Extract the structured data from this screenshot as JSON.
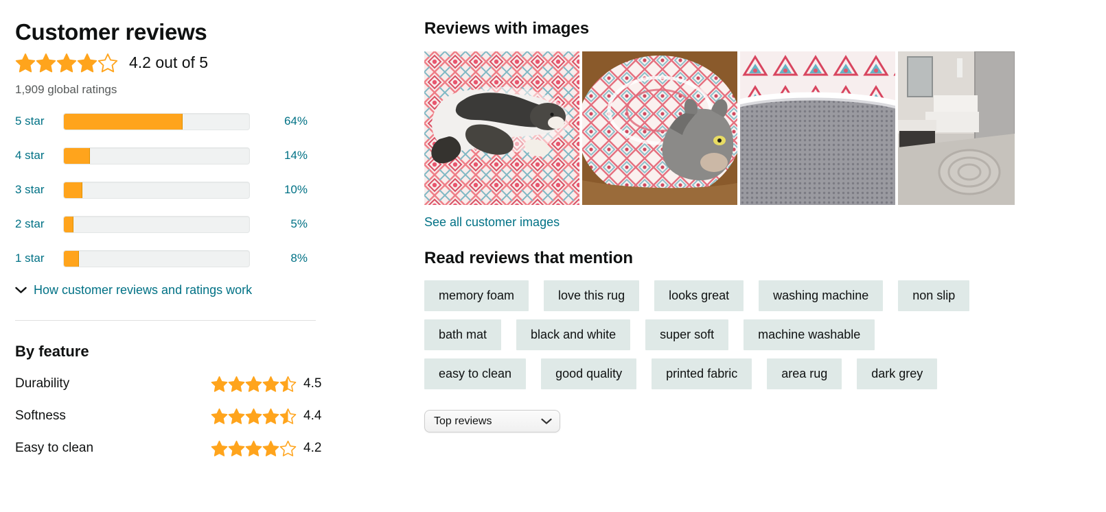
{
  "left": {
    "title": "Customer reviews",
    "average": {
      "stars_filled": 4,
      "stars_total": 5,
      "text": "4.2 out of 5",
      "value": 4.2
    },
    "global_ratings": "1,909 global ratings",
    "histogram": [
      {
        "label": "5 star",
        "percent_text": "64%",
        "percent": 64
      },
      {
        "label": "4 star",
        "percent_text": "14%",
        "percent": 14
      },
      {
        "label": "3 star",
        "percent_text": "10%",
        "percent": 10
      },
      {
        "label": "2 star",
        "percent_text": "5%",
        "percent": 5
      },
      {
        "label": "1 star",
        "percent_text": "8%",
        "percent": 8
      }
    ],
    "how_reviews_work": "How customer reviews and ratings work",
    "by_feature": {
      "title": "By feature",
      "features": [
        {
          "name": "Durability",
          "score_text": "4.5",
          "score": 4.5
        },
        {
          "name": "Softness",
          "score_text": "4.4",
          "score": 4.4
        },
        {
          "name": "Easy to clean",
          "score_text": "4.2",
          "score": 4.2
        }
      ]
    }
  },
  "right": {
    "images_title": "Reviews with images",
    "thumbnails": [
      {
        "alt": "black-and-white-cat-on-pink-mandala-rug"
      },
      {
        "alt": "grey-cat-on-round-pink-rug"
      },
      {
        "alt": "grey-mesh-rug-backing-closeup"
      },
      {
        "alt": "round-mat-on-bathroom-floor"
      }
    ],
    "see_all_images": "See all customer images",
    "mention_title": "Read reviews that mention",
    "chip_rows": [
      [
        "memory foam",
        "love this rug",
        "looks great",
        "washing machine",
        "non slip"
      ],
      [
        "bath mat",
        "black and white",
        "super soft",
        "machine washable"
      ],
      [
        "easy to clean",
        "good quality",
        "printed fabric",
        "area rug",
        "dark grey"
      ]
    ],
    "sort": {
      "selected": "Top reviews"
    }
  },
  "colors": {
    "star": "#ffa41c",
    "link": "#007185",
    "chip_bg": "#dfe9e7",
    "bar_track": "#f0f2f2"
  }
}
